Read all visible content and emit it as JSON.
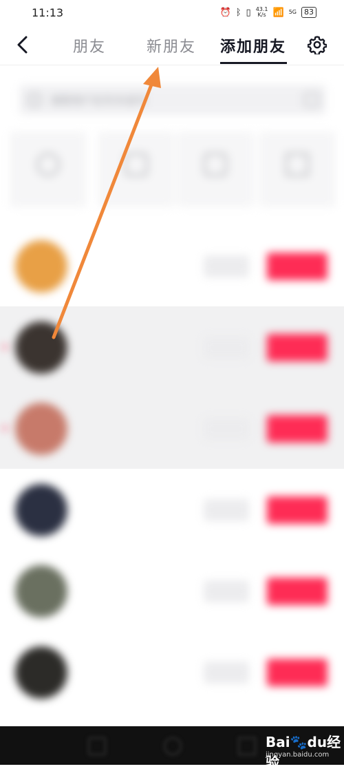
{
  "status_bar": {
    "time": "11:13",
    "net_speed_top": "43.1",
    "net_speed_bottom": "K/s",
    "signal_label": "5G",
    "battery": "83"
  },
  "nav": {
    "tabs": [
      {
        "label": "朋友"
      },
      {
        "label": "新朋友"
      },
      {
        "label": "添加朋友",
        "active": true
      }
    ]
  },
  "icons": {
    "back": "chevron-left-icon",
    "settings": "gear-icon"
  },
  "search": {
    "placeholder": "搜索用户名字/抖音号"
  },
  "shortcuts": [
    {
      "label": "",
      "icon": "share-icon"
    },
    {
      "label": "",
      "icon": "contacts-icon"
    },
    {
      "label": "",
      "icon": "qr-icon"
    },
    {
      "label": "",
      "icon": "scan-icon"
    }
  ],
  "suggestions": [
    {
      "name": "",
      "desc1": "",
      "desc2": "",
      "remove": "",
      "follow": "",
      "avatar_color": "#e8a046"
    },
    {
      "name": "",
      "desc1": "",
      "desc2": "",
      "remove": "",
      "follow": "",
      "avatar_color": "#3b3430"
    },
    {
      "name": "",
      "desc1": "",
      "desc2": "",
      "remove": "",
      "follow": "",
      "avatar_color": "#c77a6a"
    },
    {
      "name": "",
      "desc1": "",
      "desc2": "",
      "remove": "",
      "follow": "",
      "avatar_color": "#2b3042"
    },
    {
      "name": "",
      "desc1": "",
      "desc2": "",
      "remove": "",
      "follow": "",
      "avatar_color": "#6a7060"
    },
    {
      "name": "",
      "desc1": "",
      "desc2": "",
      "remove": "",
      "follow": "",
      "avatar_color": "#2c2b28"
    }
  ],
  "colors": {
    "accent": "#fe2c55",
    "annotation_arrow": "#f0883a"
  },
  "watermark": {
    "logo_a": "Bai",
    "logo_b": "du",
    "logo_c": "经验",
    "url": "jingyan.baidu.com"
  }
}
